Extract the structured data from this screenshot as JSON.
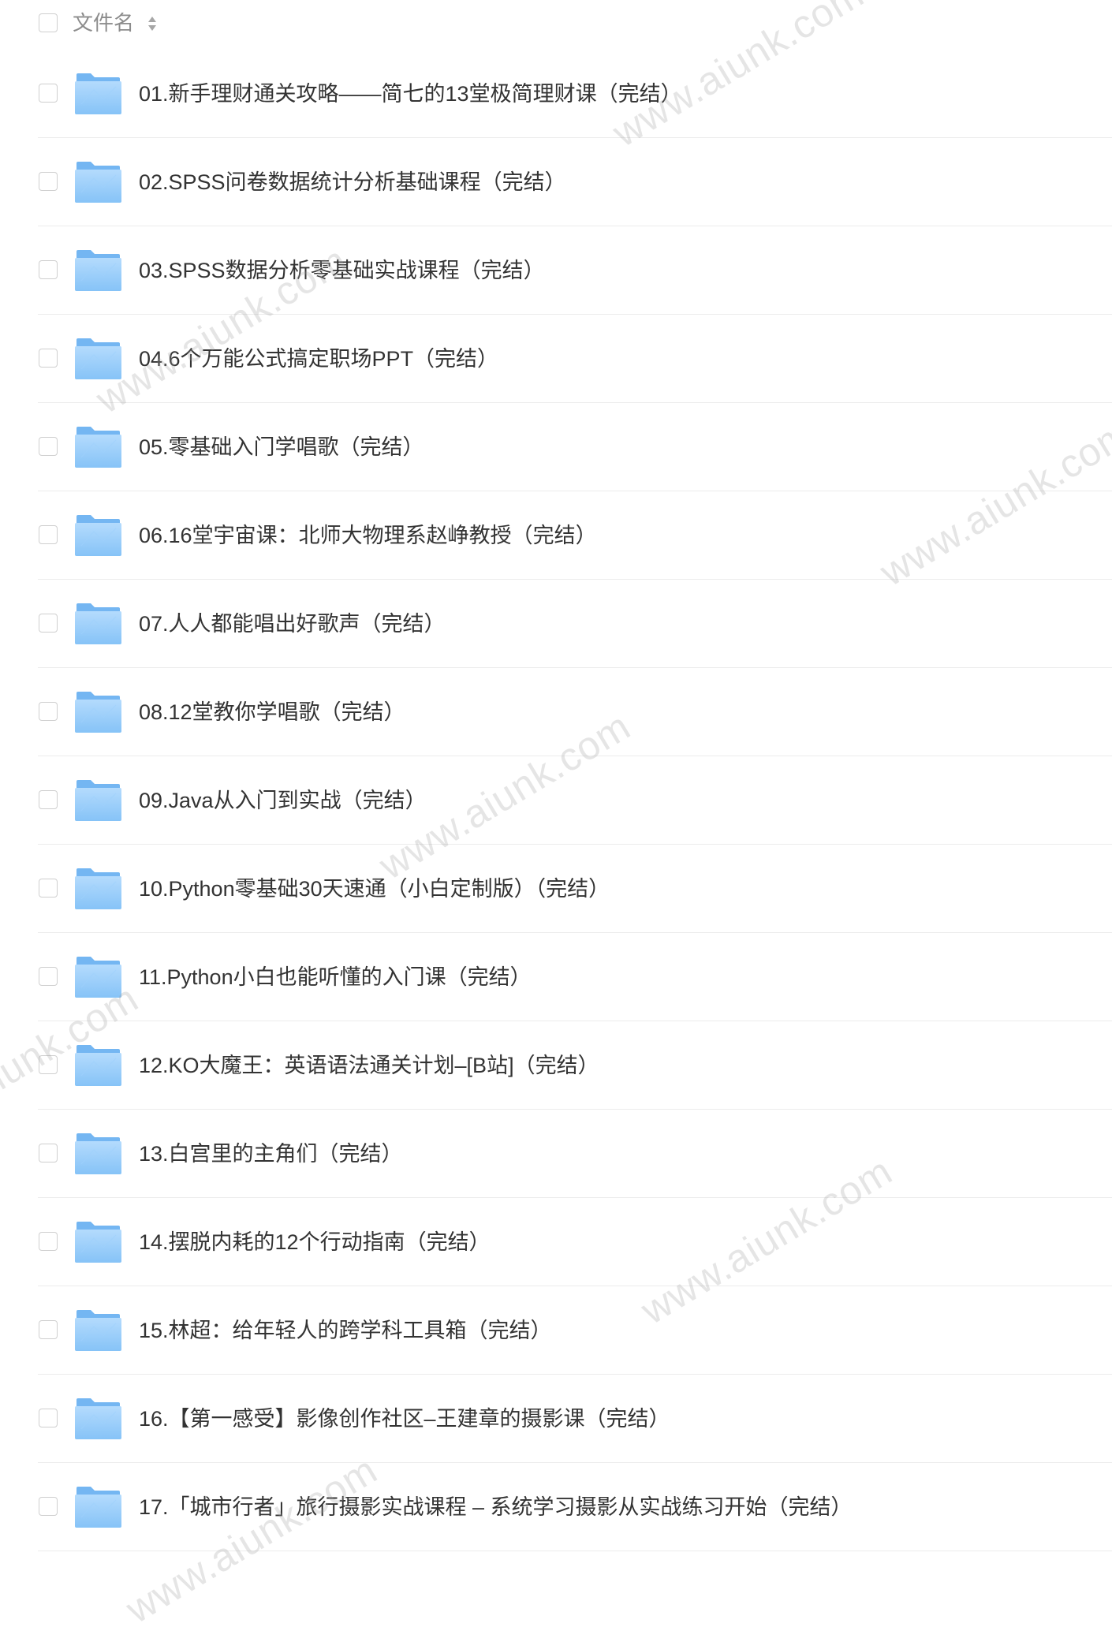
{
  "header": {
    "label": "文件名",
    "sort_icon": "sort-icon",
    "checkbox_icon": "checkbox-icon"
  },
  "file_icon": "folder-icon",
  "files": [
    {
      "name": "01.新手理财通关攻略——简七的13堂极简理财课（完结）"
    },
    {
      "name": "02.SPSS问卷数据统计分析基础课程（完结）"
    },
    {
      "name": "03.SPSS数据分析零基础实战课程（完结）"
    },
    {
      "name": "04.6个万能公式搞定职场PPT（完结）"
    },
    {
      "name": "05.零基础入门学唱歌（完结）"
    },
    {
      "name": "06.16堂宇宙课：北师大物理系赵峥教授（完结）"
    },
    {
      "name": "07.人人都能唱出好歌声（完结）"
    },
    {
      "name": "08.12堂教你学唱歌（完结）"
    },
    {
      "name": "09.Java从入门到实战（完结）"
    },
    {
      "name": "10.Python零基础30天速通（小白定制版）（完结）"
    },
    {
      "name": "11.Python小白也能听懂的入门课（完结）"
    },
    {
      "name": "12.KO大魔王：英语语法通关计划–[B站]（完结）"
    },
    {
      "name": "13.白宫里的主角们（完结）"
    },
    {
      "name": "14.摆脱内耗的12个行动指南（完结）"
    },
    {
      "name": "15.林超：给年轻人的跨学科工具箱（完结）"
    },
    {
      "name": "16.【第一感受】影像创作社区–王建章的摄影课（完结）"
    },
    {
      "name": "17.「城市行者」旅行摄影实战课程 – 系统学习摄影从实战练习开始（完结）"
    }
  ],
  "watermark": {
    "text": "www.aiunk.com"
  },
  "colors": {
    "text": "#333333",
    "header_text": "#8c8c8c",
    "divider": "#ececec",
    "checkbox_border": "#cfcfcf",
    "folder_light": "#a9d5fc",
    "folder_dark": "#74b6f2",
    "watermark": "#a0a0a0"
  }
}
